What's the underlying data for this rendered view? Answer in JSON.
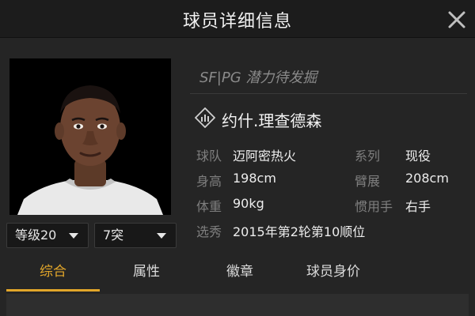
{
  "header": {
    "title": "球员详细信息",
    "close_icon": "close-icon"
  },
  "portrait": {
    "alt": "player-portrait"
  },
  "dropdowns": {
    "level": "等级20",
    "breakthrough": "7突"
  },
  "info": {
    "position_tag": "SF|PG 潜力待发掘",
    "name": "约什.理查德森",
    "name_icon": "rating-diamond-icon",
    "attributes": {
      "team_label": "球队",
      "team_value": "迈阿密热火",
      "series_label": "系列",
      "series_value": "现役",
      "height_label": "身高",
      "height_value": "198cm",
      "wingspan_label": "臂展",
      "wingspan_value": "208cm",
      "weight_label": "体重",
      "weight_value": "90kg",
      "hand_label": "惯用手",
      "hand_value": "右手",
      "draft_label": "选秀",
      "draft_value": "2015年第2轮第10顺位"
    }
  },
  "tabs": {
    "overview": "综合",
    "attributes": "属性",
    "badges": "徽章",
    "value": "球员身价"
  },
  "colors": {
    "accent": "#e2a62a",
    "background": "#252525",
    "header": "#1c1c1c"
  }
}
